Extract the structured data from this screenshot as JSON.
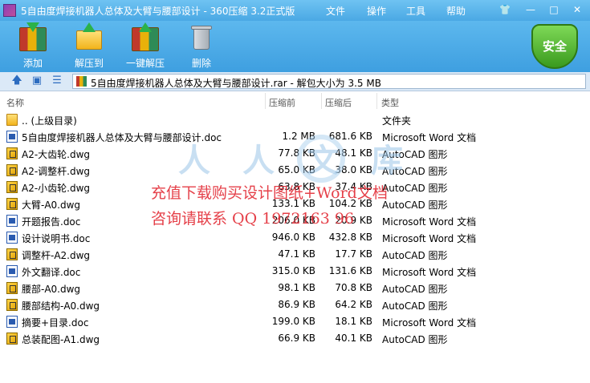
{
  "window": {
    "title": "5自由度焊接机器人总体及大臂与腰部设计 - 360压缩 3.2正式版",
    "menu": [
      "文件",
      "操作",
      "工具",
      "帮助"
    ],
    "controls": {
      "skin": "👕",
      "minimize": "—",
      "maximize": "□",
      "close": "✕"
    }
  },
  "toolbar": {
    "buttons": [
      {
        "label": "添加",
        "icon": "add-archive-icon"
      },
      {
        "label": "解压到",
        "icon": "extract-to-icon"
      },
      {
        "label": "一键解压",
        "icon": "one-click-extract-icon"
      },
      {
        "label": "删除",
        "icon": "trash-icon"
      }
    ],
    "security_badge": "安全"
  },
  "address": {
    "path": "5自由度焊接机器人总体及大臂与腰部设计.rar - 解包大小为 3.5 MB",
    "nav": {
      "up": "🡅",
      "view1": "▣",
      "view2": "☰"
    }
  },
  "columns": {
    "name": "名称",
    "compressed": "压缩前",
    "size": "压缩后",
    "type": "类型"
  },
  "files": [
    {
      "name": ".. (上级目录)",
      "before": "",
      "after": "",
      "type": "文件夹",
      "kind": "folder"
    },
    {
      "name": "5自由度焊接机器人总体及大臂与腰部设计.doc",
      "before": "1.2 MB",
      "after": "681.6 KB",
      "type": "Microsoft Word 文档",
      "kind": "doc"
    },
    {
      "name": "A2-大齿轮.dwg",
      "before": "77.8 KB",
      "after": "48.1 KB",
      "type": "AutoCAD 图形",
      "kind": "dwg"
    },
    {
      "name": "A2-调整杆.dwg",
      "before": "65.0 KB",
      "after": "38.0 KB",
      "type": "AutoCAD 图形",
      "kind": "dwg"
    },
    {
      "name": "A2-小齿轮.dwg",
      "before": "63.8 KB",
      "after": "37.4 KB",
      "type": "AutoCAD 图形",
      "kind": "dwg"
    },
    {
      "name": "大臂-A0.dwg",
      "before": "133.1 KB",
      "after": "104.2 KB",
      "type": "AutoCAD 图形",
      "kind": "dwg"
    },
    {
      "name": "开题报告.doc",
      "before": "206.0 KB",
      "after": "20.9 KB",
      "type": "Microsoft Word 文档",
      "kind": "doc"
    },
    {
      "name": "设计说明书.doc",
      "before": "946.0 KB",
      "after": "432.8 KB",
      "type": "Microsoft Word 文档",
      "kind": "doc"
    },
    {
      "name": "调整杆-A2.dwg",
      "before": "47.1 KB",
      "after": "17.7 KB",
      "type": "AutoCAD 图形",
      "kind": "dwg"
    },
    {
      "name": "外文翻译.doc",
      "before": "315.0 KB",
      "after": "131.6 KB",
      "type": "Microsoft Word 文档",
      "kind": "doc"
    },
    {
      "name": "腰部-A0.dwg",
      "before": "98.1 KB",
      "after": "70.8 KB",
      "type": "AutoCAD 图形",
      "kind": "dwg"
    },
    {
      "name": "腰部结构-A0.dwg",
      "before": "86.9 KB",
      "after": "64.2 KB",
      "type": "AutoCAD 图形",
      "kind": "dwg"
    },
    {
      "name": "摘要+目录.doc",
      "before": "199.0 KB",
      "after": "18.1 KB",
      "type": "Microsoft Word 文档",
      "kind": "doc"
    },
    {
      "name": "总装配图-A1.dwg",
      "before": "66.9 KB",
      "after": "40.1 KB",
      "type": "AutoCAD 图形",
      "kind": "dwg"
    }
  ],
  "watermark": {
    "line1": "充值下载购买设计图纸+Word文档",
    "line2": "咨询请联系  QQ  1972163 96",
    "logo": "人人文库"
  }
}
